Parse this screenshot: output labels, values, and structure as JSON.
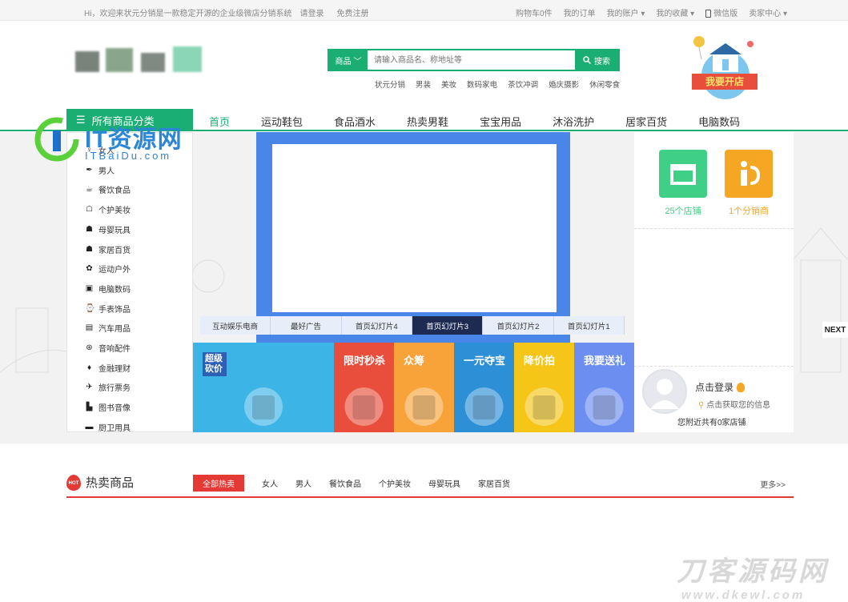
{
  "topbar": {
    "welcome": "Hi，欢迎来状元分销是一款稳定开源的企业级微店分销系统",
    "login": "请登录",
    "register": "免费注册",
    "cart": "购物车0件",
    "orders": "我的订单",
    "account": "我的账户",
    "favorites": "我的收藏",
    "wechat": "微信版",
    "seller": "卖家中心"
  },
  "search": {
    "category": "商品",
    "placeholder": "请输入商品名、称地址等",
    "button": "搜索",
    "hotwords": [
      "状元分销",
      "男装",
      "美妆",
      "数码家电",
      "茶饮冲调",
      "婚庆摄影",
      "休闲零食"
    ]
  },
  "shop_badge": "我要开店",
  "nav": {
    "all_categories": "所有商品分类",
    "links": [
      "首页",
      "运动鞋包",
      "食品酒水",
      "热卖男鞋",
      "宝宝用品",
      "沐浴洗护",
      "居家百货",
      "电脑数码"
    ]
  },
  "categories": [
    "女人",
    "男人",
    "餐饮食品",
    "个护美妆",
    "母婴玩具",
    "家居百货",
    "运动户外",
    "电脑数码",
    "手表饰品",
    "汽车用品",
    "音响配件",
    "金融理财",
    "旅行票务",
    "图书音像",
    "厨卫用具"
  ],
  "slide_tabs": [
    "互动娱乐电商",
    "最好广告",
    "首页幻灯片4",
    "首页幻灯片3",
    "首页幻灯片2",
    "首页幻灯片1"
  ],
  "promos": [
    "超级砍价",
    "限时秒杀",
    "众筹",
    "一元夺宝",
    "降价拍",
    "我要送礼"
  ],
  "stats": {
    "shops": "25个店铺",
    "distributors": "1个分销商"
  },
  "login_panel": {
    "title": "点击登录",
    "subtitle": "点击获取您的信息",
    "nearby": "您附近共有0家店铺"
  },
  "next_label": "NEXT",
  "hot": {
    "title": "热卖商品",
    "tabs": [
      "全部热卖",
      "女人",
      "男人",
      "餐饮食品",
      "个护美妆",
      "母婴玩具",
      "家居百货"
    ],
    "more": "更多>>"
  },
  "watermarks": {
    "top_cn": "IT资源网",
    "top_en": "ITBaiDu.com",
    "bottom_cn": "刀客源码网",
    "bottom_en": "www.dkewl.com"
  },
  "colors": {
    "green": "#1bae72",
    "red": "#e53935",
    "slider_blue": "#4a86e8",
    "orange": "#f5a623"
  }
}
